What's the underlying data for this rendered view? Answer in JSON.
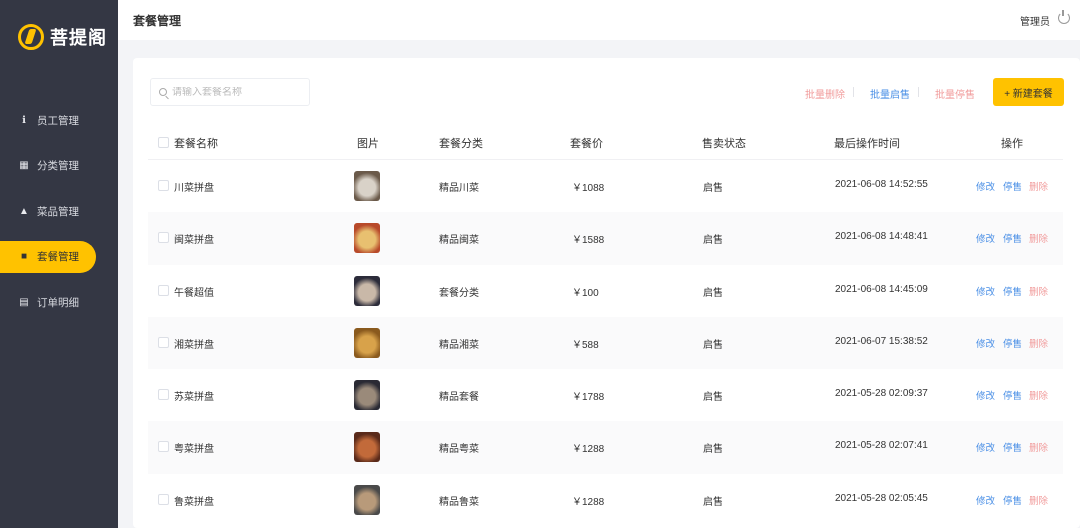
{
  "app": {
    "logo_text": "菩提阁"
  },
  "sidebar": {
    "items": [
      {
        "label": "员工管理",
        "icon": "info-circle-icon",
        "glyph": "ℹ",
        "active": false
      },
      {
        "label": "分类管理",
        "icon": "grid-icon",
        "glyph": "▦",
        "active": false
      },
      {
        "label": "菜品管理",
        "icon": "dish-icon",
        "glyph": "▲",
        "active": false
      },
      {
        "label": "套餐管理",
        "icon": "gift-icon",
        "glyph": "■",
        "active": true
      },
      {
        "label": "订单明细",
        "icon": "clipboard-icon",
        "glyph": "▤",
        "active": false
      }
    ]
  },
  "header": {
    "title": "套餐管理",
    "user": "管理员"
  },
  "toolbar": {
    "search_placeholder": "请输入套餐名称",
    "batch_delete": "批量删除",
    "batch_enable": "批量启售",
    "batch_disable": "批量停售",
    "new_button": "+ 新建套餐"
  },
  "table": {
    "headers": [
      "套餐名称",
      "图片",
      "套餐分类",
      "套餐价",
      "售卖状态",
      "最后操作时间",
      "操作"
    ],
    "actions": {
      "edit": "修改",
      "stop": "停售",
      "delete": "删除"
    },
    "rows": [
      {
        "name": "川菜拼盘",
        "category": "精品川菜",
        "price": "￥1088",
        "status": "启售",
        "time": "2021-06-08 14:52:55",
        "thumb": [
          "#6b5a4a",
          "#d9d2c8"
        ]
      },
      {
        "name": "闽菜拼盘",
        "category": "精品闽菜",
        "price": "￥1588",
        "status": "启售",
        "time": "2021-06-08 14:48:41",
        "thumb": [
          "#b84a2a",
          "#e8c070"
        ]
      },
      {
        "name": "午餐超值",
        "category": "套餐分类",
        "price": "￥100",
        "status": "启售",
        "time": "2021-06-08 14:45:09",
        "thumb": [
          "#2c2c3a",
          "#c9b8a8"
        ]
      },
      {
        "name": "湘菜拼盘",
        "category": "精品湘菜",
        "price": "￥588",
        "status": "启售",
        "time": "2021-06-07 15:38:52",
        "thumb": [
          "#8a5a1e",
          "#d8a24a"
        ]
      },
      {
        "name": "苏菜拼盘",
        "category": "精品套餐",
        "price": "￥1788",
        "status": "启售",
        "time": "2021-05-28 02:09:37",
        "thumb": [
          "#2a2a34",
          "#9a8a7a"
        ]
      },
      {
        "name": "粤菜拼盘",
        "category": "精品粤菜",
        "price": "￥1288",
        "status": "启售",
        "time": "2021-05-28 02:07:41",
        "thumb": [
          "#5a2a1a",
          "#c26a3a"
        ]
      },
      {
        "name": "鲁菜拼盘",
        "category": "精品鲁菜",
        "price": "￥1288",
        "status": "启售",
        "time": "2021-05-28 02:05:45",
        "thumb": [
          "#4a4a4a",
          "#b89a7a"
        ]
      }
    ]
  },
  "colors": {
    "sidebar_bg": "#343744",
    "accent": "#ffc200",
    "link_blue": "#4a8fe6",
    "link_red": "#f19b9b"
  }
}
